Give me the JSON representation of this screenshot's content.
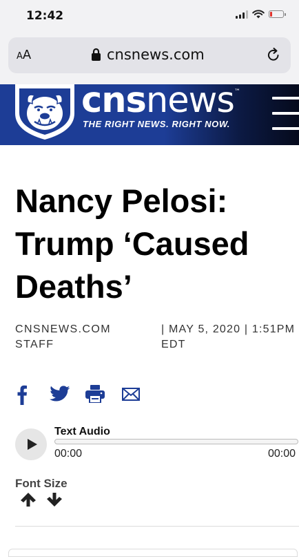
{
  "status_bar": {
    "time": "12:42",
    "battery_level": 0.2,
    "battery_color": "#e0322b"
  },
  "browser": {
    "aa_label_small": "A",
    "aa_label_large": "A",
    "url": "cnsnews.com",
    "lock_icon": "lock-icon",
    "reload_icon": "reload-icon"
  },
  "site": {
    "logo_word_bold": "cns",
    "logo_word_light": "news",
    "trademark": "™",
    "tagline": "THE RIGHT NEWS. RIGHT NOW.",
    "brand_color": "#1d3d96"
  },
  "article": {
    "headline": "Nancy Pelosi: Trump ‘Caused Deaths’",
    "byline_line1": "CNSNEWS.COM",
    "byline_line2": "STAFF",
    "date_line1": "| MAY 5, 2020 | 1:51PM",
    "date_line2": "EDT"
  },
  "share": {
    "icons": [
      "facebook-icon",
      "twitter-icon",
      "print-icon",
      "email-icon"
    ],
    "icon_color": "#1d3d96"
  },
  "audio": {
    "title": "Text Audio",
    "current_time": "00:00",
    "duration": "00:00"
  },
  "font_size": {
    "label": "Font Size"
  }
}
